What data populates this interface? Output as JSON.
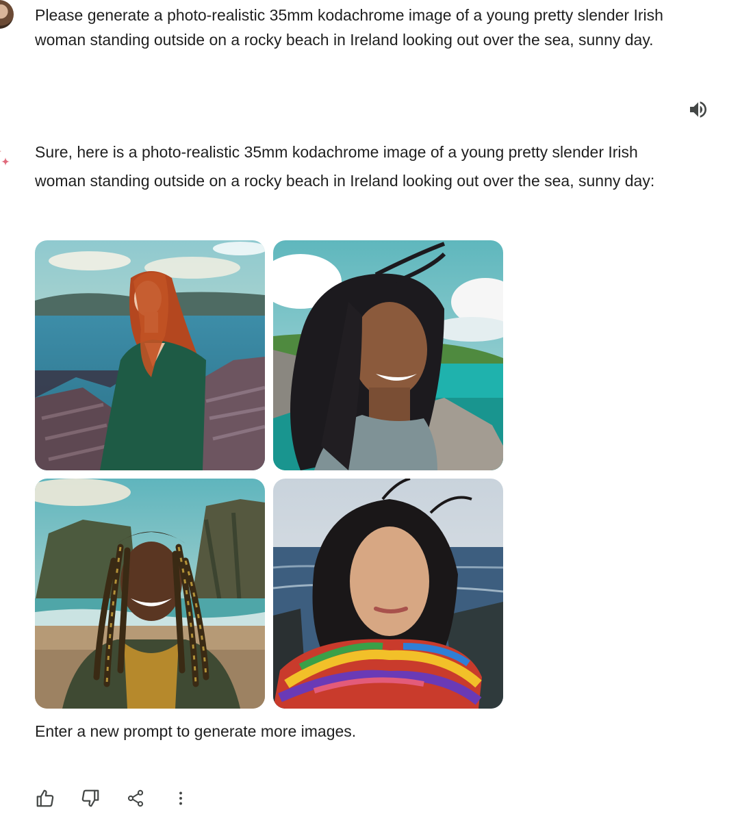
{
  "user_message": {
    "text": "Please generate a photo-realistic 35mm kodachrome image of a young pretty slender Irish woman standing outside on a rocky beach in Ireland looking out over the sea, sunny day."
  },
  "read_aloud": {
    "icon": "speaker-icon"
  },
  "response": {
    "icon": "sparkle-icon",
    "text": "Sure, here is a photo-realistic 35mm kodachrome image of a young pretty slender Irish woman standing outside on a rocky beach in Ireland looking out over the sea, sunny day:",
    "images": [
      {
        "icon": "generated-image"
      },
      {
        "icon": "generated-image"
      },
      {
        "icon": "generated-image"
      },
      {
        "icon": "generated-image"
      }
    ],
    "footer": "Enter a new prompt to generate more images."
  },
  "actions": [
    {
      "icon": "thumbs-up-icon"
    },
    {
      "icon": "thumbs-down-icon"
    },
    {
      "icon": "share-icon"
    },
    {
      "icon": "more-vert-icon"
    }
  ],
  "colors": {
    "text": "#1f1f1f",
    "icon": "#444746",
    "sparkle_red": "#d9534f",
    "sparkle_pink": "#e06b7d"
  }
}
